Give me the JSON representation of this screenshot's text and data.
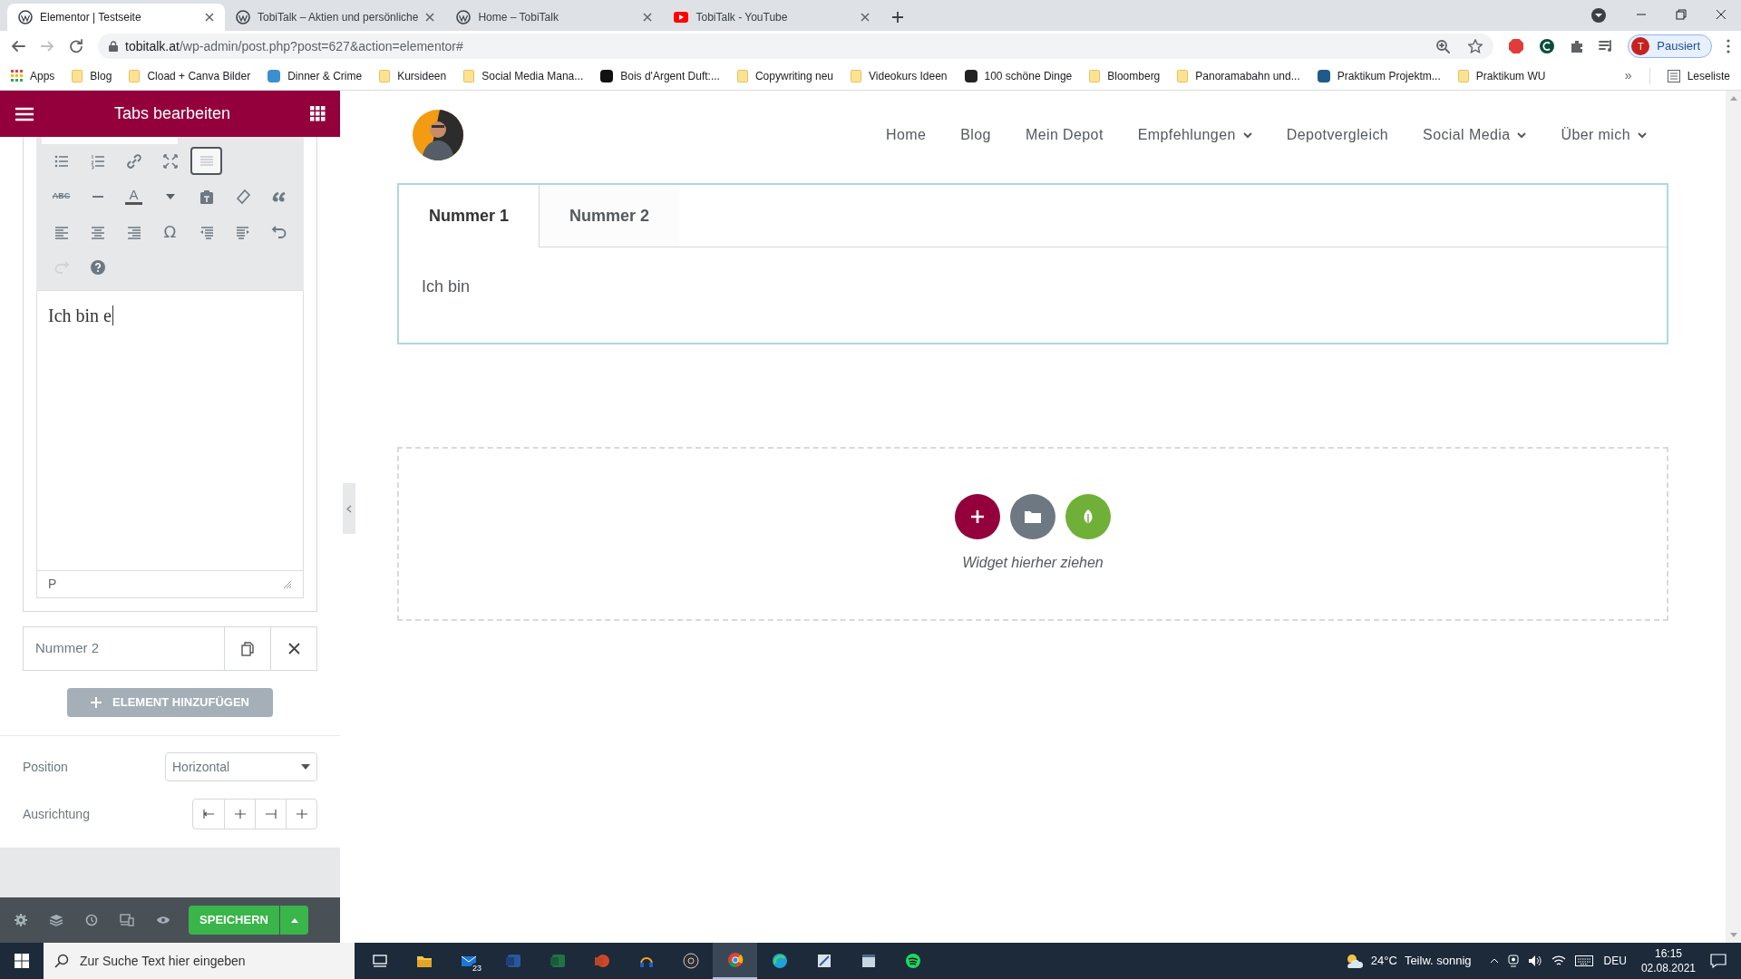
{
  "browser": {
    "tabs": [
      {
        "title": "Elementor | Testseite",
        "kind": "wp",
        "selected": true
      },
      {
        "title": "TobiTalk – Aktien und persönliche",
        "kind": "wp",
        "selected": false
      },
      {
        "title": "Home – TobiTalk",
        "kind": "wp",
        "selected": false
      },
      {
        "title": "TobiTalk - YouTube",
        "kind": "yt",
        "selected": false
      }
    ],
    "address": {
      "host": "tobitalk.at",
      "path": "/wp-admin/post.php?post=627&action=elementor#"
    },
    "profile": {
      "initial": "T",
      "label": "Pausiert"
    },
    "bookmarks": [
      {
        "label": "Apps",
        "kind": "apps"
      },
      {
        "label": "Blog",
        "kind": "folder"
      },
      {
        "label": "Cload + Canva Bilder",
        "kind": "folder"
      },
      {
        "label": "Dinner & Crime",
        "kind": "site",
        "color": "#3b8fd1"
      },
      {
        "label": "Kursideen",
        "kind": "folder"
      },
      {
        "label": "Social Media Mana...",
        "kind": "folder"
      },
      {
        "label": "Bois d'Argent Duft:...",
        "kind": "site",
        "color": "#111111"
      },
      {
        "label": "Copywriting neu",
        "kind": "folder"
      },
      {
        "label": "Videokurs Ideen",
        "kind": "folder"
      },
      {
        "label": "100 schöne Dinge",
        "kind": "site",
        "color": "#222222"
      },
      {
        "label": "Bloomberg",
        "kind": "folder"
      },
      {
        "label": "Panoramabahn und...",
        "kind": "folder"
      },
      {
        "label": "Praktikum Projektm...",
        "kind": "site",
        "color": "#1e5a8a"
      },
      {
        "label": "Praktikum WU",
        "kind": "folder"
      }
    ],
    "more": "»",
    "reading_list": "Leseliste"
  },
  "panel": {
    "title": "Tabs bearbeiten",
    "toolbar": [
      [
        {
          "kind": "bullets",
          "pressed": false
        },
        {
          "kind": "numbers",
          "pressed": false
        },
        {
          "kind": "link",
          "pressed": false
        },
        {
          "kind": "fullscreen",
          "pressed": false
        },
        {
          "kind": "toggle",
          "pressed": true
        }
      ],
      [
        {
          "kind": "strike",
          "glyph": "ABC",
          "pressed": false
        },
        {
          "kind": "hr",
          "pressed": false
        },
        {
          "kind": "color",
          "glyph": "A",
          "pressed": false
        },
        {
          "kind": "caret",
          "pressed": false
        },
        {
          "kind": "paste",
          "pressed": false
        },
        {
          "kind": "eraser",
          "pressed": false
        },
        {
          "kind": "quote",
          "pressed": false
        }
      ],
      [
        {
          "kind": "alignleft",
          "pressed": false
        },
        {
          "kind": "aligncenter",
          "pressed": false
        },
        {
          "kind": "alignright",
          "pressed": false
        },
        {
          "kind": "omega",
          "glyph": "Ω",
          "pressed": false
        },
        {
          "kind": "outdent",
          "pressed": false
        },
        {
          "kind": "indent",
          "pressed": false
        },
        {
          "kind": "undo",
          "pressed": false
        }
      ],
      [
        {
          "kind": "redo",
          "pressed": false,
          "disabled": true
        },
        {
          "kind": "help",
          "pressed": false
        }
      ]
    ],
    "editor_text": "Ich bin e",
    "editor_status": "P",
    "items": [
      {
        "title": "Nummer 2"
      }
    ],
    "add_button": "ELEMENT HINZUFÜGEN",
    "position": {
      "label": "Position",
      "value": "Horizontal"
    },
    "alignment": {
      "label": "Ausrichtung"
    },
    "save": "SPEICHERN"
  },
  "site": {
    "nav": [
      {
        "label": "Home",
        "dropdown": false
      },
      {
        "label": "Blog",
        "dropdown": false
      },
      {
        "label": "Mein Depot",
        "dropdown": false
      },
      {
        "label": "Empfehlungen",
        "dropdown": true
      },
      {
        "label": "Depotvergleich",
        "dropdown": false
      },
      {
        "label": "Social Media",
        "dropdown": true
      },
      {
        "label": "Über mich",
        "dropdown": true
      }
    ],
    "tabs": [
      {
        "label": "Nummer 1",
        "selected": true
      },
      {
        "label": "Nummer 2",
        "selected": false
      }
    ],
    "tab_content": "Ich bin",
    "drop_hint": "Widget hierher ziehen"
  },
  "taskbar": {
    "search_placeholder": "Zur Suche Text hier eingeben",
    "apps": [
      {
        "kind": "taskview",
        "active": false
      },
      {
        "kind": "explorer",
        "active": false
      },
      {
        "kind": "mail",
        "badge": "23",
        "active": false
      },
      {
        "kind": "word",
        "active": false
      },
      {
        "kind": "excel",
        "active": false
      },
      {
        "kind": "powerpoint",
        "active": false
      },
      {
        "kind": "headset",
        "active": false
      },
      {
        "kind": "obs",
        "active": false
      },
      {
        "kind": "chrome",
        "active": true
      },
      {
        "kind": "edge",
        "active": false
      },
      {
        "kind": "tool",
        "active": false
      },
      {
        "kind": "window",
        "active": false
      },
      {
        "kind": "spotify",
        "active": false
      }
    ],
    "temperature": "24°C",
    "weather": "Teilw. sonnig",
    "language": "DEU",
    "time": "16:15",
    "date": "02.08.2021"
  }
}
